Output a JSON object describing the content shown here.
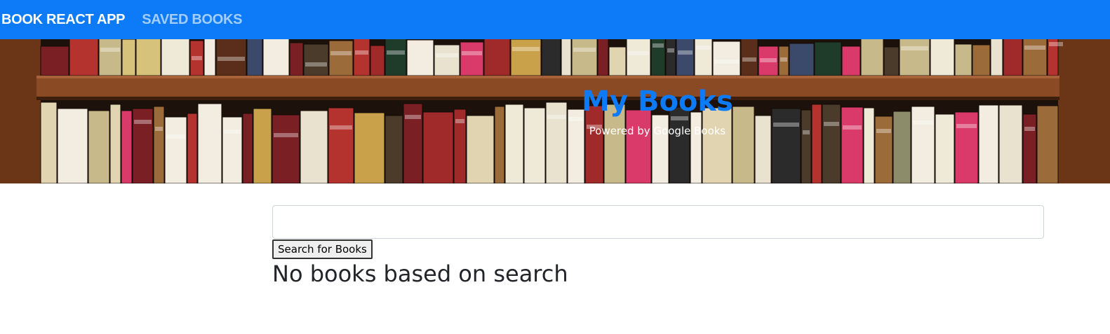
{
  "navbar": {
    "brand": "BOOK REACT APP",
    "saved_link": "SAVED BOOKS"
  },
  "hero": {
    "title": "My Books",
    "subtitle": "Powered by Google Books"
  },
  "search": {
    "value": "",
    "placeholder": "",
    "button_label": "Search for Books"
  },
  "results": {
    "empty_message": "No books based on search"
  },
  "colors": {
    "navbar_bg": "#0d7bf7",
    "accent": "#0d7bf7",
    "shelf_wood": "#8a4a24"
  }
}
